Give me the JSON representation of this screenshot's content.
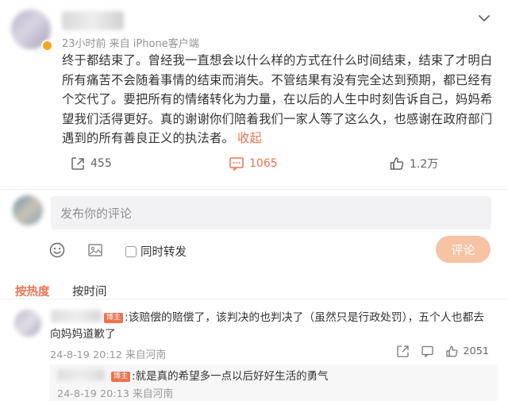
{
  "post": {
    "meta": "23小时前  来自 iPhone客户端",
    "text": "终于都结束了。曾经我一直想会以什么样的方式在什么时间结束，结束了才明白所有痛苦不会随着事情的结束而消失。不管结果有没有完全达到预期，都已经有个交代了。要把所有的情绪转化为力量，在以后的人生中时刻告诉自己，妈妈希望我们活得更好。真的谢谢你们陪着我们一家人等了这么久，也感谢在政府部门遇到的所有善良正义的执法者。",
    "collapse_label": "收起",
    "reposts": "455",
    "comments": "1065",
    "likes": "1.2万"
  },
  "composer": {
    "placeholder": "发布你的评论",
    "repost_label": "同时转发",
    "submit_label": "评论"
  },
  "sort": {
    "hot_label": "按热度",
    "time_label": "按时间"
  },
  "comments": [
    {
      "badge": "博主",
      "text": ":该赔偿的赔偿了，该判决的也判决了（虽然只是行政处罚），五个人也都去向妈妈道歉了",
      "meta": "24-8-19 20:12  来自河南",
      "likes": "2051",
      "reply": {
        "badge": "博主",
        "text": ":就是真的希望多一点以后好好生活的勇气",
        "meta": "24-8-19 20:13  来自河南"
      }
    }
  ],
  "colors": {
    "accent": "#eb7350",
    "button_disabled": "#f6c3a5",
    "input_bg": "#f2f2f5"
  },
  "icons": [
    "chevron-down-icon",
    "repost-icon",
    "comment-icon",
    "like-icon",
    "emoji-icon",
    "image-icon",
    "share-icon"
  ]
}
